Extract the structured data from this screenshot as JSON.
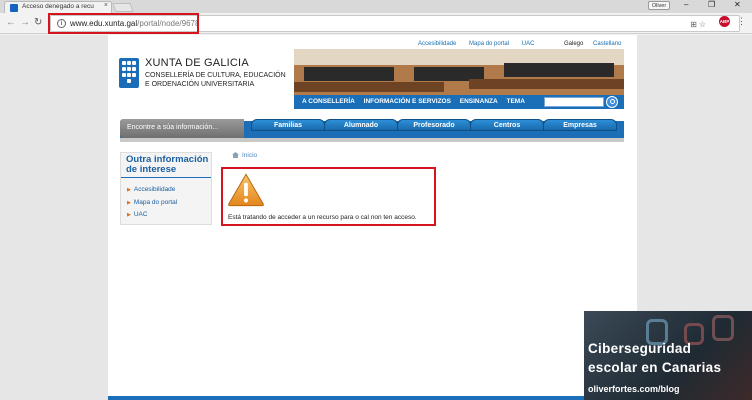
{
  "browser": {
    "tab_title": "Acceso denegado a recu",
    "tab_close": "×",
    "profile_name": "Oliver",
    "window_controls": {
      "minimize": "–",
      "restore": "❐",
      "close": "✕"
    },
    "url_host": "www.edu.xunta.gal",
    "url_path": "/portal/node/9678",
    "abp_label": "ABP",
    "icons": [
      "back-icon",
      "forward-icon",
      "reload-icon",
      "info-icon",
      "translate-icon",
      "star-icon",
      "menu-icon"
    ]
  },
  "header": {
    "brand_name": "XUNTA DE GALICIA",
    "brand_sub_line1": "CONSELLERÍA DE CULTURA, EDUCACIÓN",
    "brand_sub_line2": "E ORDENACIÓN UNIVERSITARIA",
    "util_links": [
      "Accesibilidade",
      "Mapa do portal",
      "UAC"
    ],
    "lang_current": "Galego",
    "lang_other": "Castellano",
    "topnav": [
      "A CONSELLERÍA",
      "INFORMACIÓN E SERVIZOS",
      "ENSINANZA",
      "TEMA"
    ]
  },
  "mainnav": {
    "prompt": "Encontre a súa información...",
    "tabs": [
      "Familias",
      "Alumnado",
      "Profesorado",
      "Centros",
      "Empresas"
    ]
  },
  "sidebar": {
    "title": "Outra información de interese",
    "items": [
      "Accesibilidade",
      "Mapa do portal",
      "UAC"
    ]
  },
  "content": {
    "breadcrumb": "Inicio",
    "message": "Está tratando de acceder a un recurso para o cal non ten acceso."
  },
  "watermark": {
    "line1": "Ciberseguridad",
    "line2": "escolar en Canarias",
    "line3": "oliverfortes.com/blog"
  },
  "colors": {
    "brand_blue": "#1a6fb8",
    "alert_red": "#d6141e",
    "warning_orange": "#f0a030"
  }
}
